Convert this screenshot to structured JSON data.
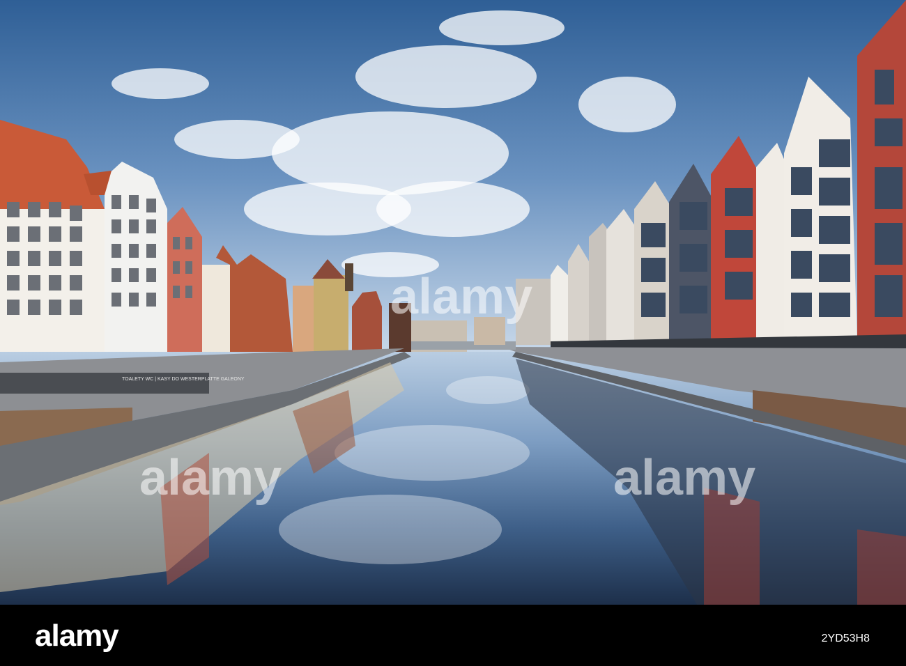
{
  "photo": {
    "sign_text": "TOALETY WC | KASY DO WESTERPLATTE GALEONY",
    "watermark": "alamy"
  },
  "footer": {
    "logo": "alamy",
    "image_id": "2YD53H8"
  }
}
